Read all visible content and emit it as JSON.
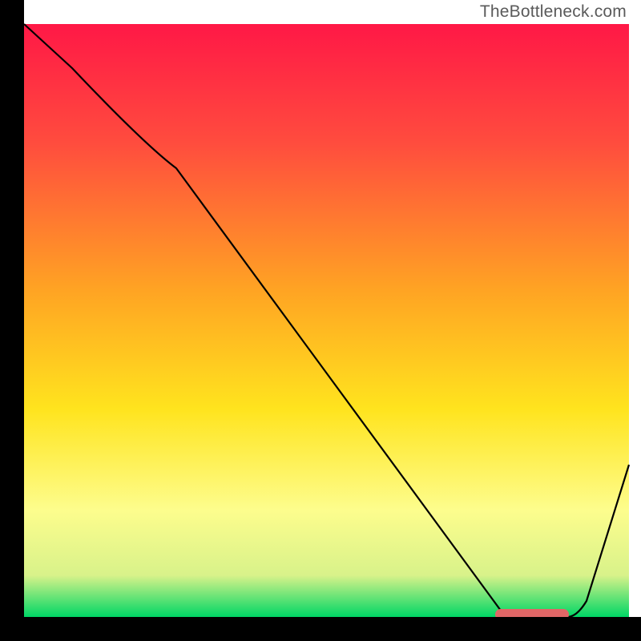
{
  "watermark": "TheBottleneck.com",
  "chart_data": {
    "type": "line",
    "title": "",
    "xlabel": "",
    "ylabel": "",
    "xlim": [
      0,
      100
    ],
    "ylim": [
      0,
      100
    ],
    "x": [
      0,
      25,
      80,
      90,
      100
    ],
    "values": [
      100,
      78,
      0,
      0,
      26
    ],
    "marker_segment": {
      "x_start": 78,
      "x_end": 90,
      "y": 0
    },
    "colors": {
      "gradient_stops": [
        {
          "offset": 0.0,
          "color": "#ff1846"
        },
        {
          "offset": 0.2,
          "color": "#ff4c3e"
        },
        {
          "offset": 0.45,
          "color": "#ffa423"
        },
        {
          "offset": 0.65,
          "color": "#ffe41e"
        },
        {
          "offset": 0.82,
          "color": "#fdfd8d"
        },
        {
          "offset": 0.93,
          "color": "#d8f28a"
        },
        {
          "offset": 1.0,
          "color": "#00d665"
        }
      ],
      "line": "#000000",
      "frame": "#000000",
      "marker": "#e06666"
    }
  }
}
